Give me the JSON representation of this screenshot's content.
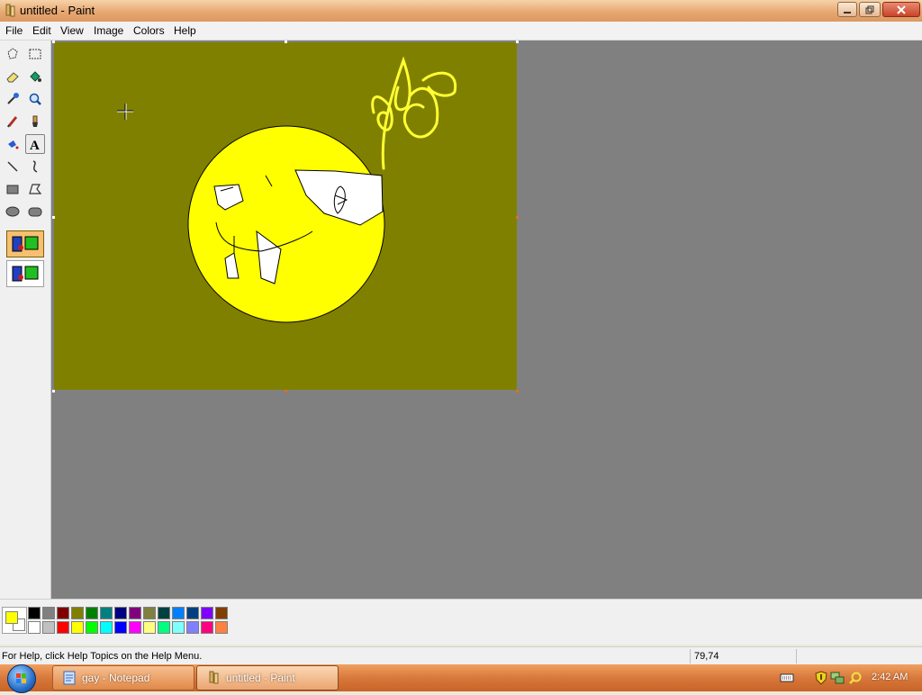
{
  "window": {
    "title": "untitled - Paint",
    "buttons": [
      "minimize-button",
      "restore-button",
      "close-button"
    ]
  },
  "menu": {
    "items": [
      "File",
      "Edit",
      "View",
      "Image",
      "Colors",
      "Help"
    ]
  },
  "toolbox": {
    "tools": [
      "free-form-select",
      "select",
      "eraser",
      "fill-with-color",
      "pick-color",
      "magnifier",
      "pencil",
      "brush",
      "airbrush",
      "text",
      "line",
      "curve",
      "rectangle",
      "polygon",
      "ellipse",
      "rounded-rectangle"
    ],
    "active_tool": "text"
  },
  "canvas": {
    "background": "#808000",
    "circle_fill": "#ffff00",
    "scribble_color": "#ffff33"
  },
  "palette": {
    "foreground": "#ffff00",
    "background": "#ffffff",
    "row1": [
      "#000000",
      "#808080",
      "#800000",
      "#808000",
      "#008000",
      "#008080",
      "#000080",
      "#800080",
      "#808040",
      "#004040",
      "#0080ff",
      "#004080",
      "#8000ff",
      "#804000"
    ],
    "row2": [
      "#ffffff",
      "#c0c0c0",
      "#ff0000",
      "#ffff00",
      "#00ff00",
      "#00ffff",
      "#0000ff",
      "#ff00ff",
      "#ffff80",
      "#00ff80",
      "#80ffff",
      "#8080ff",
      "#ff0080",
      "#ff8040"
    ]
  },
  "status": {
    "help_text": "For Help, click Help Topics on the Help Menu.",
    "coords": "79,74"
  },
  "taskbar": {
    "buttons": [
      {
        "label": "gay - Notepad",
        "icon": "notepad-icon",
        "active": false
      },
      {
        "label": "untitled - Paint",
        "icon": "paint-icon",
        "active": true
      }
    ],
    "tray_icons": [
      "keyboard-icon",
      "shield-icon",
      "network-icon",
      "search-icon"
    ],
    "clock": "2:42 AM"
  }
}
